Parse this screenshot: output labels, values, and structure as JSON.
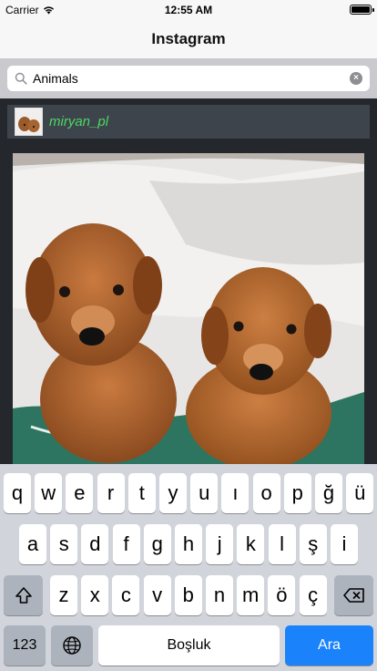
{
  "status_bar": {
    "carrier": "Carrier",
    "time": "12:55 AM"
  },
  "nav": {
    "title": "Instagram"
  },
  "search": {
    "value": "Animals",
    "placeholder": ""
  },
  "user": {
    "username": "miryan_pl"
  },
  "keyboard": {
    "row1": [
      "q",
      "w",
      "e",
      "r",
      "t",
      "y",
      "u",
      "ı",
      "o",
      "p",
      "ğ",
      "ü"
    ],
    "row2": [
      "a",
      "s",
      "d",
      "f",
      "g",
      "h",
      "j",
      "k",
      "l",
      "ş",
      "i"
    ],
    "row3": [
      "z",
      "x",
      "c",
      "v",
      "b",
      "n",
      "m",
      "ö",
      "ç"
    ],
    "numbers_label": "123",
    "space_label": "Boşluk",
    "search_label": "Ara"
  },
  "colors": {
    "username": "#4cd964",
    "search_key": "#1a82fb"
  }
}
